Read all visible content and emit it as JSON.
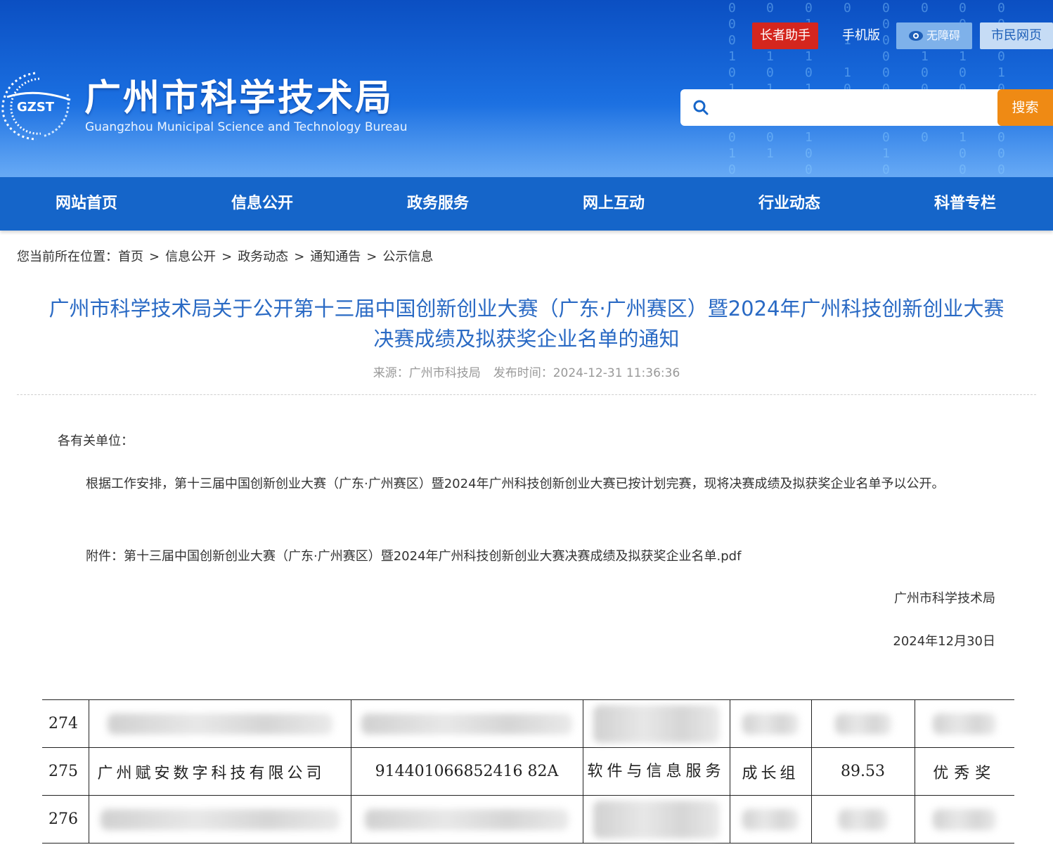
{
  "header": {
    "logo_text": "GZST",
    "title": "广州市科学技术局",
    "subtitle": "Guangzhou Municipal Science and Technology Bureau",
    "top_links": {
      "elder_assistant": "长者助手",
      "mobile": "手机版",
      "accessibility": "无障碍",
      "citizen_page": "市民网页"
    },
    "search": {
      "placeholder": "",
      "button_label": "搜索"
    },
    "colors": {
      "primary": "#1565c9",
      "accent_red": "#d4261e",
      "search_orange": "#ef8a14"
    }
  },
  "nav": {
    "items": [
      "网站首页",
      "信息公开",
      "政务服务",
      "网上互动",
      "行业动态",
      "科普专栏"
    ]
  },
  "breadcrumb": {
    "prefix": "您当前所在位置：",
    "items": [
      "首页",
      "信息公开",
      "政务动态",
      "通知通告",
      "公示信息"
    ],
    "separator": ">"
  },
  "article": {
    "title": "广州市科学技术局关于公开第十三届中国创新创业大赛（广东·广州赛区）暨2024年广州科技创新创业大赛决赛成绩及拟获奖企业名单的通知",
    "source_label": "来源：",
    "source": "广州市科技局",
    "published_label": "发布时间：",
    "published": "2024-12-31 11:36:36",
    "salutation": "各有关单位：",
    "body": "根据工作安排，第十三届中国创新创业大赛（广东·广州赛区）暨2024年广州科技创新创业大赛已按计划完赛，现将决赛成绩及拟获奖企业名单予以公开。",
    "attachment": "附件：第十三届中国创新创业大赛（广东·广州赛区）暨2024年广州科技创新创业大赛决赛成绩及拟获奖企业名单.pdf",
    "signature": "广州市科学技术局",
    "date": "2024年12月30日"
  },
  "table": {
    "rows": [
      {
        "no": "274",
        "blurred": true
      },
      {
        "no": "275",
        "blurred": false,
        "company": "广州赋安数字科技有限公司",
        "credit_code": "914401066852416 82A",
        "industry": "软件与信息服务",
        "group": "成长组",
        "score": "89.53",
        "award": "优秀奖"
      },
      {
        "no": "276",
        "blurred": true
      }
    ]
  }
}
